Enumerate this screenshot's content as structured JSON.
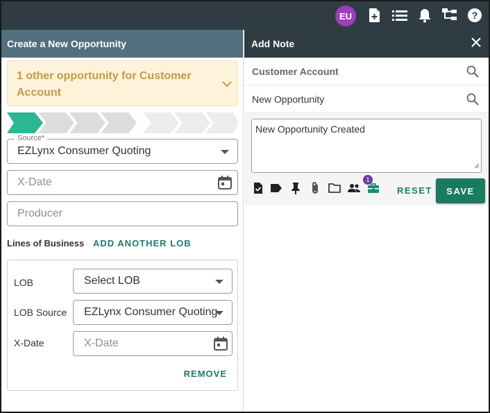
{
  "topbar": {
    "avatar_initials": "EU",
    "icons": [
      "add-document-icon",
      "list-icon",
      "bell-icon",
      "hierarchy-icon",
      "help-icon"
    ]
  },
  "left_panel": {
    "title": "Create a New Opportunity",
    "alert": {
      "text": "1 other opportunity for Customer Account"
    },
    "stepper": {
      "total_steps": 8,
      "active_step": 1
    },
    "source": {
      "legend": "Source*",
      "value": "EZLynx Consumer Quoting"
    },
    "xdate": {
      "placeholder": "X-Date"
    },
    "producer": {
      "placeholder": "Producer"
    },
    "lines_of_business": {
      "title": "Lines of Business",
      "add_label": "ADD ANOTHER LOB",
      "lob_label": "LOB",
      "lob_value": "Select LOB",
      "lob_source_label": "LOB Source",
      "lob_source_value": "EZLynx Consumer Quoting",
      "xdate_label": "X-Date",
      "xdate_placeholder": "X-Date",
      "remove_label": "REMOVE"
    }
  },
  "right_panel": {
    "title": "Add Note",
    "customer_account": "Customer Account",
    "opportunity": "New Opportunity",
    "note_text": "New Opportunity Created",
    "tools": [
      "task-icon",
      "tag-icon",
      "pin-icon",
      "attachment-icon",
      "folder-icon",
      "people-icon",
      "briefcase-icon"
    ],
    "people_badge": "1",
    "reset_label": "RESET",
    "save_label": "SAVE"
  },
  "colors": {
    "topbar": "#2f3c44",
    "left_header": "#52707e",
    "accent_green": "#1a7a62",
    "alert_bg": "#fdf3da",
    "alert_text": "#c39a48",
    "avatar": "#9d3fb8",
    "step_active": "#2bb795"
  }
}
